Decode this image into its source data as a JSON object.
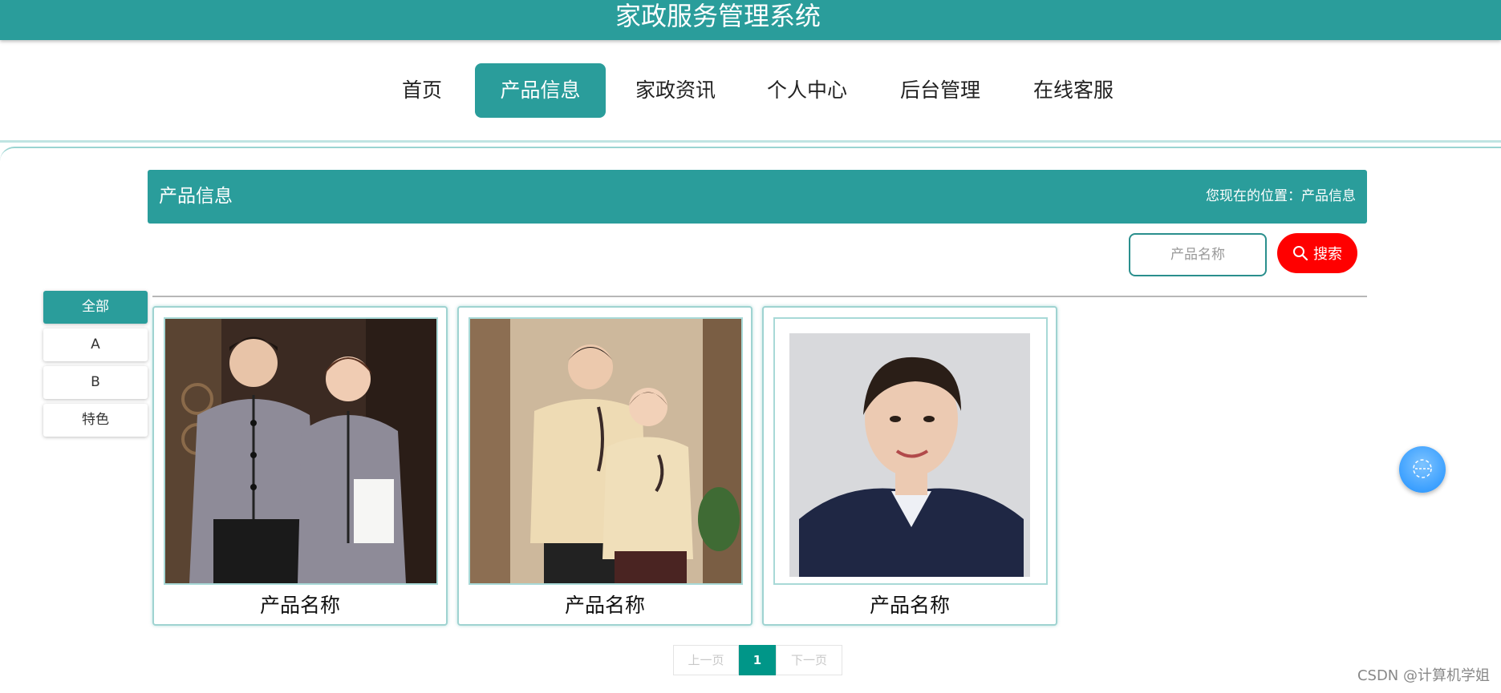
{
  "header": {
    "title": "家政服务管理系统",
    "bg_color": "#2a9d9b"
  },
  "nav": {
    "items": [
      {
        "label": "首页"
      },
      {
        "label": "产品信息",
        "active": true
      },
      {
        "label": "家政资讯"
      },
      {
        "label": "个人中心"
      },
      {
        "label": "后台管理"
      },
      {
        "label": "在线客服"
      }
    ]
  },
  "banner": {
    "title": "产品信息",
    "breadcrumb": "您现在的位置：产品信息"
  },
  "search": {
    "placeholder": "产品名称",
    "button_label": "搜索",
    "button_color": "#ff0000"
  },
  "categories": [
    {
      "label": "全部",
      "active": true
    },
    {
      "label": "A"
    },
    {
      "label": "B"
    },
    {
      "label": "特色"
    }
  ],
  "products": [
    {
      "name": "产品名称",
      "image": "uniform-photo-grey"
    },
    {
      "name": "产品名称",
      "image": "uniform-photo-beige"
    },
    {
      "name": "产品名称",
      "image": "portrait-photo"
    }
  ],
  "pagination": {
    "prev_label": "上一页",
    "current": "1",
    "next_label": "下一页"
  },
  "float_button": {
    "icon": "chat-service-icon"
  },
  "watermark": "CSDN @计算机学姐"
}
